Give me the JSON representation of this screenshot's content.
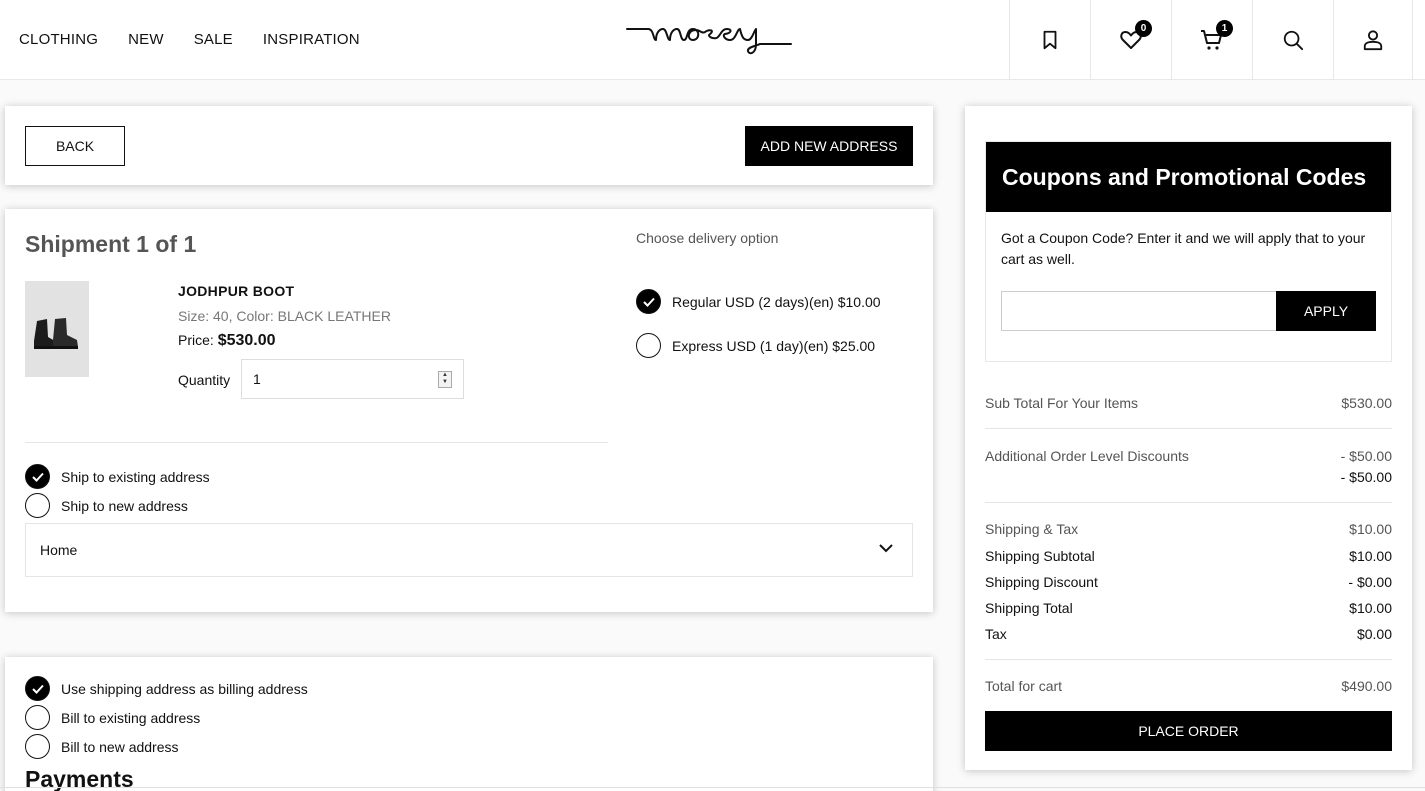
{
  "nav": [
    "CLOTHING",
    "NEW",
    "SALE",
    "INSPIRATION"
  ],
  "brand": "mosey",
  "header_icons": {
    "wishlist_count": "0",
    "cart_count": "1"
  },
  "toolbar": {
    "back_label": "BACK",
    "add_address_label": "ADD NEW ADDRESS"
  },
  "shipment": {
    "title": "Shipment 1 of 1",
    "product_name": "JODHPUR BOOT",
    "product_meta": "Size: 40, Color: BLACK LEATHER",
    "price_label": "Price:",
    "price_value": "$530.00",
    "quantity_label": "Quantity",
    "quantity_value": "1",
    "delivery_title": "Choose delivery option",
    "delivery_options": [
      {
        "label": "Regular USD (2 days)(en) $10.00",
        "selected": true
      },
      {
        "label": "Express USD (1 day)(en) $25.00",
        "selected": false
      }
    ],
    "address_options": [
      {
        "label": "Ship to existing address",
        "selected": true
      },
      {
        "label": "Ship to new address",
        "selected": false
      }
    ],
    "address_select_value": "Home"
  },
  "billing": {
    "options": [
      {
        "label": "Use shipping address as billing address",
        "selected": true
      },
      {
        "label": "Bill to existing address",
        "selected": false
      },
      {
        "label": "Bill to new address",
        "selected": false
      }
    ],
    "payments_title": "Payments"
  },
  "coupon": {
    "title": "Coupons and Promotional Codes",
    "text": "Got a Coupon Code? Enter it and we will apply that to your cart as well.",
    "input_value": "",
    "apply_label": "APPLY"
  },
  "summary": {
    "subtotal_label": "Sub Total For Your Items",
    "subtotal_value": "$530.00",
    "discount_label": "Additional Order Level Discounts",
    "discount_values": [
      "- $50.00",
      "- $50.00"
    ],
    "shipping_tax_label": "Shipping & Tax",
    "shipping_tax_value": "$10.00",
    "shipping_subtotal_label": "Shipping Subtotal",
    "shipping_subtotal_value": "$10.00",
    "shipping_discount_label": "Shipping Discount",
    "shipping_discount_value": "- $0.00",
    "shipping_total_label": "Shipping Total",
    "shipping_total_value": "$10.00",
    "tax_label": "Tax",
    "tax_value": "$0.00",
    "total_label": "Total for cart",
    "total_value": "$490.00",
    "place_order_label": "PLACE ORDER"
  }
}
